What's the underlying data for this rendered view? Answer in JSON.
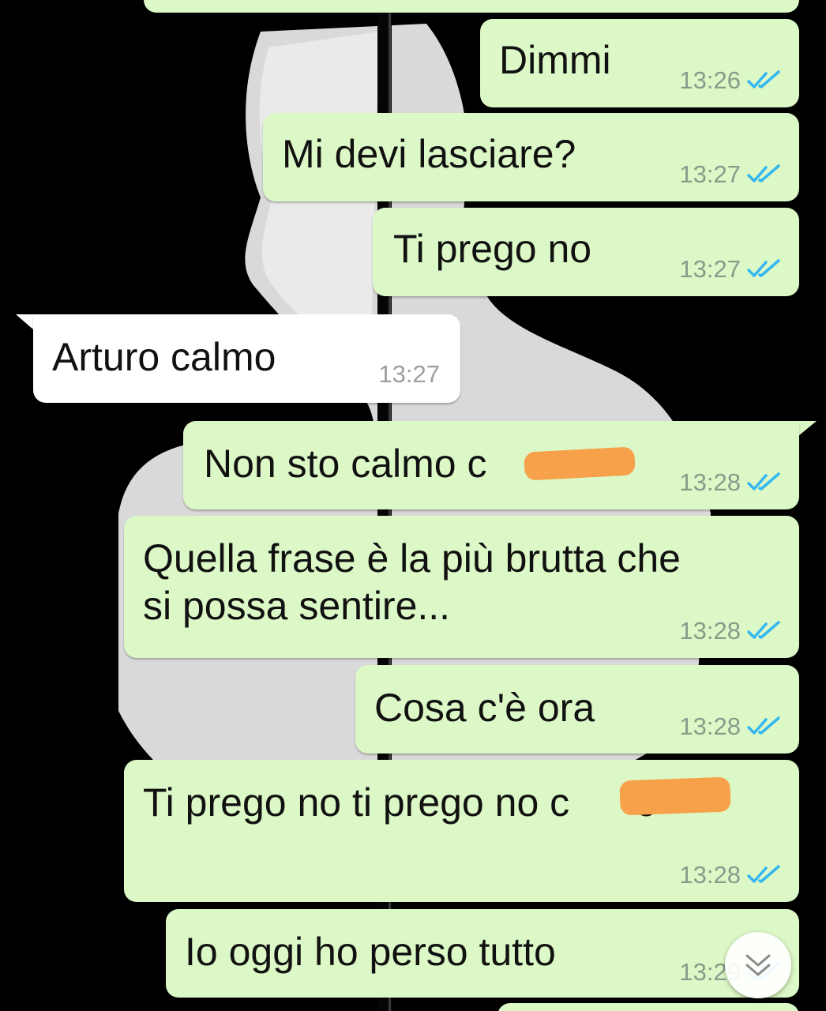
{
  "chat": {
    "messages": [
      {
        "id": "m1",
        "direction": "out",
        "text": "Dimmi",
        "time": "13:26",
        "status": "read"
      },
      {
        "id": "m2",
        "direction": "out",
        "text": "Mi devi lasciare?",
        "time": "13:27",
        "status": "read"
      },
      {
        "id": "m3",
        "direction": "out",
        "text": "Ti prego no",
        "time": "13:27",
        "status": "read"
      },
      {
        "id": "m4",
        "direction": "in",
        "text": "Arturo calmo",
        "time": "13:27"
      },
      {
        "id": "m5",
        "direction": "out",
        "text": "Non sto calmo c    o",
        "time": "13:28",
        "status": "read",
        "redacted": true
      },
      {
        "id": "m6",
        "direction": "out",
        "text": "Quella frase è la più brutta che\nsi possa sentire...",
        "time": "13:28",
        "status": "read"
      },
      {
        "id": "m7",
        "direction": "out",
        "text": "Cosa c'è ora",
        "time": "13:28",
        "status": "read"
      },
      {
        "id": "m8",
        "direction": "out",
        "text": "Ti prego no ti prego no c      o",
        "time": "13:28",
        "status": "read",
        "redacted": true
      },
      {
        "id": "m9",
        "direction": "out",
        "text": "Io oggi ho perso tutto",
        "time": "13:29",
        "status": "read"
      }
    ]
  },
  "colors": {
    "outgoing_bubble": "#dcf8c6",
    "incoming_bubble": "#ffffff",
    "read_ticks": "#34b7f1",
    "redaction": "#f7a14a",
    "wallpaper_bg": "#000000"
  },
  "icons": {
    "read_receipt": "double-check-icon",
    "scroll_down": "chevron-down-icon"
  }
}
